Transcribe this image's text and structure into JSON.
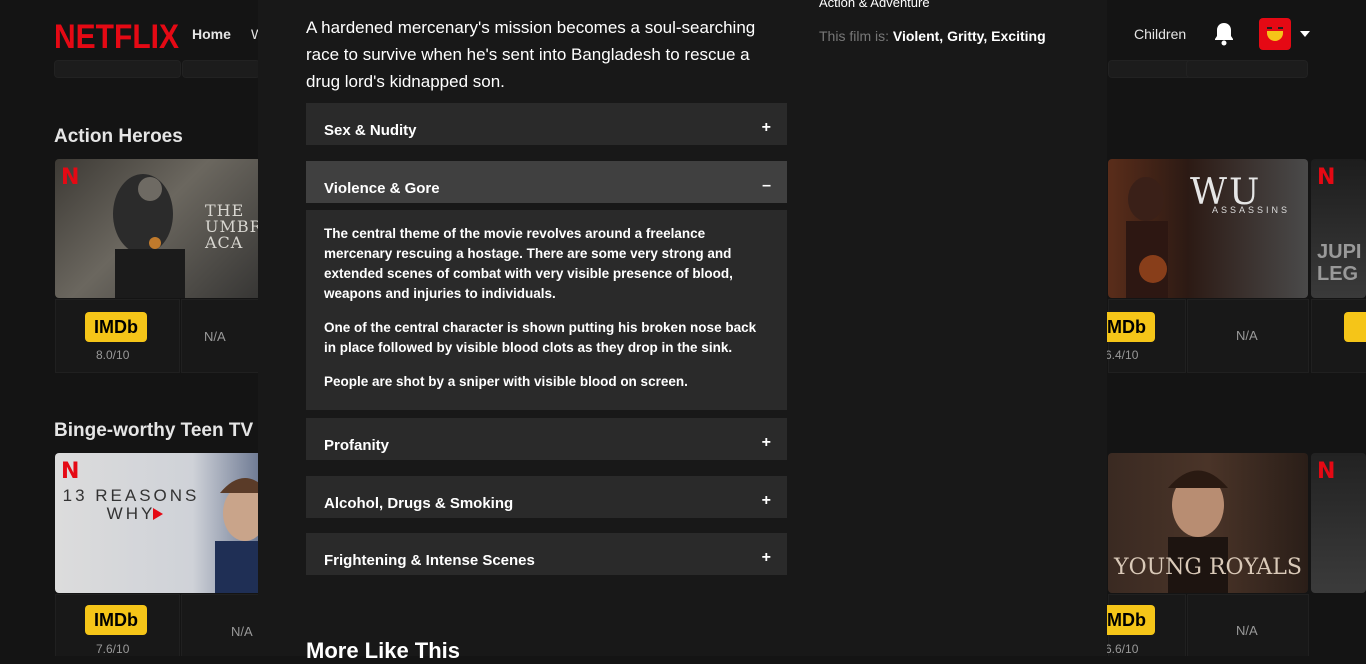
{
  "nav": {
    "logo": "NETFLIX",
    "home": "Home",
    "truncated_link": "W",
    "children": "Children",
    "bell_icon": "bell-icon",
    "avatar_icon": "profile-avatar-icon",
    "caret_icon": "caret-down-icon"
  },
  "rows": [
    {
      "title": "Action Heroes",
      "left_tile": {
        "imdb": "IMDb",
        "score": "8.0/10",
        "na": "N/A"
      },
      "right_tile": {
        "imdb": "IMDb",
        "score": "6.4/10",
        "na": "N/A",
        "poster_text": "WU ASSASSINS"
      },
      "left_poster_text": "THE UMBRE ACA",
      "far_right_text": "JUPI LEG"
    },
    {
      "title": "Binge-worthy Teen TV",
      "left_tile": {
        "imdb": "IMDb",
        "score": "7.6/10",
        "na": "N/A"
      },
      "right_tile": {
        "imdb": "IMDb",
        "score": "6.6/10",
        "na": "N/A",
        "poster_text": "YOUNG ROYALS"
      },
      "left_poster_text": "13 REASONS WHY"
    }
  ],
  "modal": {
    "synopsis": "A hardened mercenary's mission becomes a soul-searching race to survive when he's sent into Bangladesh to rescue a drug lord's kidnapped son.",
    "genre": "Action & Adventure",
    "traits_label": "This film is:",
    "traits_value": "Violent, Gritty, Exciting",
    "accordions": [
      {
        "label": "Sex & Nudity",
        "sign": "+"
      },
      {
        "label": "Violence & Gore",
        "sign": "–"
      },
      {
        "label": "Profanity",
        "sign": "+"
      },
      {
        "label": "Alcohol, Drugs & Smoking",
        "sign": "+"
      },
      {
        "label": "Frightening & Intense Scenes",
        "sign": "+"
      }
    ],
    "violence_body": [
      "The central theme of the movie revolves around a freelance mercenary rescuing a hostage. There are some very strong and extended scenes of combat with very visible presence of blood, weapons and injuries to individuals.",
      "One of the central character is shown putting his broken nose back in place followed by visible blood clots as they drop in the sink.",
      "People are shot by a sniper with visible blood on screen."
    ],
    "more_like_this": "More Like This"
  },
  "colors": {
    "brand_red": "#e50914",
    "imdb_yellow": "#f5c518",
    "modal_bg": "#181818",
    "accordion_bg": "#2a2a2a",
    "accordion_open_bg": "#404040"
  }
}
